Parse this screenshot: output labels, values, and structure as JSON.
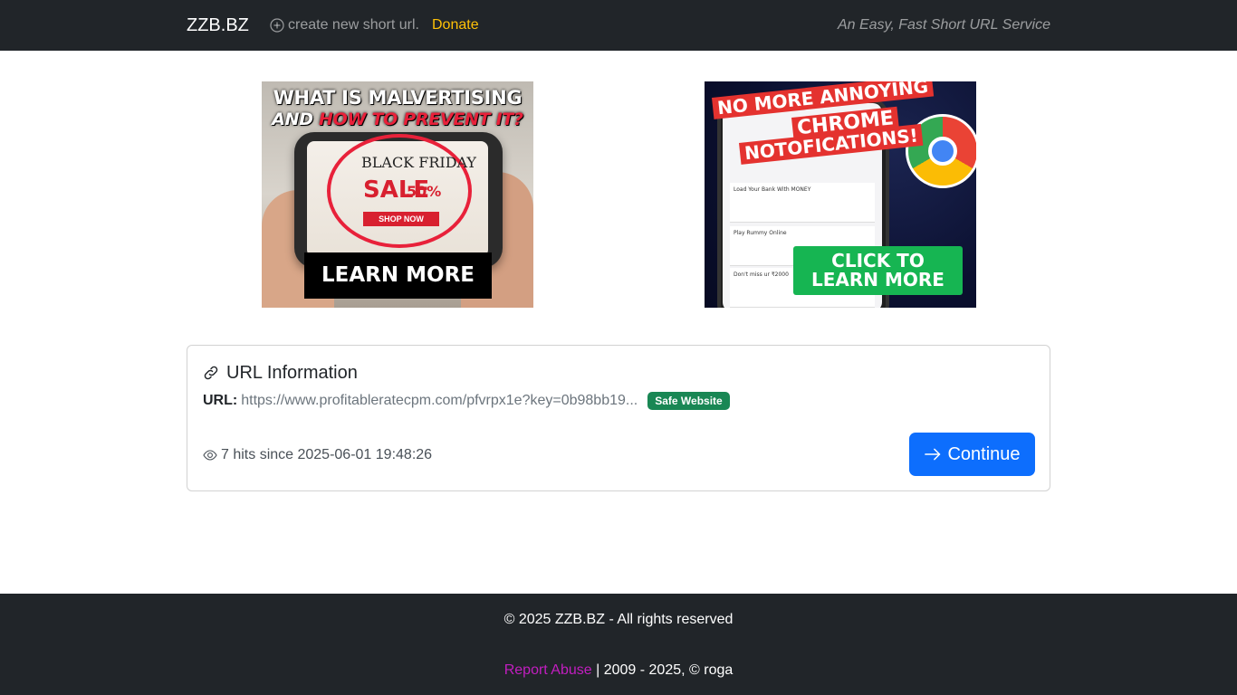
{
  "navbar": {
    "brand": "ZZB.BZ",
    "new_url_label": "create new short url.",
    "donate_label": "Donate",
    "tagline": "An Easy, Fast Short URL Service"
  },
  "ads": {
    "left": {
      "line1": "WHAT IS MALVERTISING",
      "line2_prefix": "AND",
      "line2_highlight": "HOW TO PREVENT IT?",
      "sale_top": "BLACK FRIDAY",
      "sale_word": "SALE",
      "sale_pct": "50%",
      "shop_label": "SHOP NOW",
      "cta": "LEARN MORE"
    },
    "right": {
      "banner1": "NO MORE ANNOYING",
      "banner2": "CHROME",
      "banner3": "NOTOFICATIONS!",
      "notif1": "Load Your Bank With MONEY",
      "notif2": "Play Rummy Online",
      "notif3": "Don't miss ur ₹2000",
      "cta_line1": "CLICK TO",
      "cta_line2": "LEARN MORE"
    }
  },
  "card": {
    "title": "URL Information",
    "url_label": "URL:",
    "url_value": "https://www.profitableratecpm.com/pfvrpx1e?key=0b98bb19...",
    "safe_badge": "Safe Website",
    "hits_text": "7 hits since 2025-06-01 19:48:26",
    "continue_label": "Continue"
  },
  "footer": {
    "copyright": "© 2025 ZZB.BZ - All rights reserved",
    "report_label": "Report Abuse",
    "years_text": " | 2009 - 2025, © roga"
  },
  "colors": {
    "navbar_bg": "#212529",
    "donate": "#ffc107",
    "safe_badge_bg": "#198754",
    "continue_bg": "#0d6efd",
    "report_link": "#c21ec0"
  },
  "icons": {
    "new_url": "plus-circle-icon",
    "title": "link-icon",
    "hits": "eye-icon",
    "continue": "arrow-right-icon"
  }
}
